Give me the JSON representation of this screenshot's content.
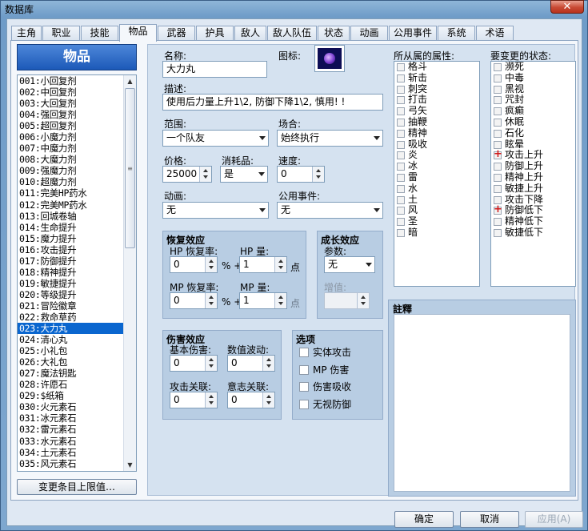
{
  "window": {
    "title": "数据库",
    "close_glyph": "✕"
  },
  "tabs": [
    "主角",
    "职业",
    "技能",
    "物品",
    "武器",
    "护具",
    "敌人",
    "敌人队伍",
    "状态",
    "动画",
    "公用事件",
    "系统",
    "术语"
  ],
  "active_tab": "物品",
  "list": {
    "header": "物品",
    "selected_index": 22,
    "items": [
      "001:小回复剂",
      "002:中回复剂",
      "003:大回复剂",
      "004:强回复剂",
      "005:超回复剂",
      "006:小魔力剂",
      "007:中魔力剂",
      "008:大魔力剂",
      "009:强魔力剂",
      "010:超魔力剂",
      "011:完美HP药水",
      "012:完美MP药水",
      "013:回城卷轴",
      "014:生命提升",
      "015:魔力提升",
      "016:攻击提升",
      "017:防御提升",
      "018:精神提升",
      "019:敏捷提升",
      "020:等级提升",
      "021:冒险徽章",
      "022:救命草药",
      "023:大力丸",
      "024:清心丸",
      "025:小礼包",
      "026:大礼包",
      "027:魔法钥匙",
      "028:许愿石",
      "029:$纸箱",
      "030:火元素石",
      "031:冰元素石",
      "032:雷元素石",
      "033:水元素石",
      "034:土元素石",
      "035:风元素石"
    ],
    "change_max_button": "变更条目上限值…"
  },
  "form": {
    "name_label": "名称:",
    "name_value": "大力丸",
    "icon_label": "图标:",
    "desc_label": "描述:",
    "desc_value": "使用后力量上升1\\2, 防御下降1\\2, 慎用! !",
    "scope_label": "范围:",
    "scope_value": "一个队友",
    "occasion_label": "场合:",
    "occasion_value": "始终执行",
    "price_label": "价格:",
    "price_value": "25000",
    "consumable_label": "消耗品:",
    "consumable_value": "是",
    "speed_label": "速度:",
    "speed_value": "0",
    "animation_label": "动画:",
    "animation_value": "无",
    "common_event_label": "公用事件:",
    "common_event_value": "无"
  },
  "recovery": {
    "title": "恢复效应",
    "hp_rate_label": "HP 恢复率:",
    "hp_rate_value": "0",
    "hp_amount_label": "HP 量:",
    "hp_amount_value": "1",
    "mp_rate_label": "MP 恢复率:",
    "mp_rate_value": "0",
    "mp_amount_label": "MP 量:",
    "mp_amount_value": "1",
    "percent_plus": "% +",
    "points": "点"
  },
  "growth": {
    "title": "成长效应",
    "param_label": "参数:",
    "param_value": "无",
    "increase_label": "增值:",
    "increase_value": ""
  },
  "damage": {
    "title": "伤害效应",
    "base_label": "基本伤害:",
    "base_value": "0",
    "variance_label": "数值波动:",
    "variance_value": "0",
    "atk_label": "攻击关联:",
    "atk_value": "0",
    "mdf_label": "意志关联:",
    "mdf_value": "0"
  },
  "options": {
    "title": "选项",
    "items": [
      "实体攻击",
      "MP 伤害",
      "伤害吸收",
      "无视防御"
    ]
  },
  "elements": {
    "label": "所从属的属性:",
    "items": [
      "格斗",
      "斩击",
      "刺突",
      "打击",
      "弓矢",
      "抽鞭",
      "精神",
      "吸收",
      "炎",
      "冰",
      "雷",
      "水",
      "土",
      "风",
      "圣",
      "暗"
    ]
  },
  "states": {
    "label": "要变更的状态:",
    "items": [
      {
        "name": "濒死",
        "mark": ""
      },
      {
        "name": "中毒",
        "mark": ""
      },
      {
        "name": "黑视",
        "mark": ""
      },
      {
        "name": "咒封",
        "mark": ""
      },
      {
        "name": "疯癫",
        "mark": ""
      },
      {
        "name": "休眠",
        "mark": ""
      },
      {
        "name": "石化",
        "mark": ""
      },
      {
        "name": "眩晕",
        "mark": ""
      },
      {
        "name": "攻击上升",
        "mark": "+"
      },
      {
        "name": "防御上升",
        "mark": ""
      },
      {
        "name": "精神上升",
        "mark": ""
      },
      {
        "name": "敏捷上升",
        "mark": ""
      },
      {
        "name": "攻击下降",
        "mark": ""
      },
      {
        "name": "防御低下",
        "mark": "+"
      },
      {
        "name": "精神低下",
        "mark": ""
      },
      {
        "name": "敏捷低下",
        "mark": ""
      }
    ]
  },
  "notes": {
    "label": "註釋"
  },
  "buttons": {
    "ok": "确定",
    "cancel": "取消",
    "apply": "应用(A)"
  }
}
